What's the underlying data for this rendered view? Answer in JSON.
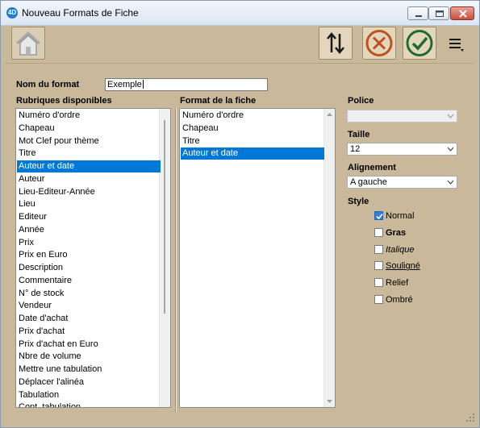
{
  "window": {
    "title": "Nouveau Formats de Fiche",
    "app_icon_text": "4D"
  },
  "toolbar": {
    "home_icon": "home-icon",
    "sort_icon": "sort-up-down-icon",
    "cancel_icon": "cancel-circle-icon",
    "ok_icon": "ok-check-circle-icon",
    "menu_icon": "hamburger-menu-icon",
    "colors": {
      "cancel": "#c0501e",
      "ok": "#1f6b2e"
    }
  },
  "form": {
    "name_label": "Nom du format",
    "name_value": "Exemple"
  },
  "available": {
    "header": "Rubriques disponibles",
    "items": [
      "Numéro d'ordre",
      "Chapeau",
      "Mot Clef pour thème",
      "Titre",
      "Auteur et date",
      "Auteur",
      "Lieu-Editeur-Année",
      "Lieu",
      "Editeur",
      "Année",
      "Prix",
      "Prix en Euro",
      "Description",
      "Commentaire",
      "N° de stock",
      "Vendeur",
      "Date d'achat",
      "Prix d'achat",
      "Prix d'achat en Euro",
      "Nbre de volume",
      "Mettre une tabulation",
      "Déplacer l'alinéa",
      "Tabulation",
      "Cont. tabulation"
    ],
    "selected_index": 4
  },
  "format": {
    "header": "Format de la fiche",
    "items": [
      "Numéro d'ordre",
      "Chapeau",
      "Titre",
      "Auteur et date"
    ],
    "selected_index": 3
  },
  "options": {
    "police_label": "Police",
    "police_value": "",
    "taille_label": "Taille",
    "taille_value": "12",
    "alignement_label": "Alignement",
    "alignement_value": "A gauche",
    "style_label": "Style",
    "styles": [
      {
        "label": "Normal",
        "checked": true
      },
      {
        "label": "Gras",
        "checked": false
      },
      {
        "label": "Italique",
        "checked": false
      },
      {
        "label": "Souligné",
        "checked": false
      },
      {
        "label": "Relief",
        "checked": false
      },
      {
        "label": "Ombré",
        "checked": false
      }
    ]
  },
  "colors": {
    "background": "#c9b99a",
    "selection": "#0078d7"
  }
}
